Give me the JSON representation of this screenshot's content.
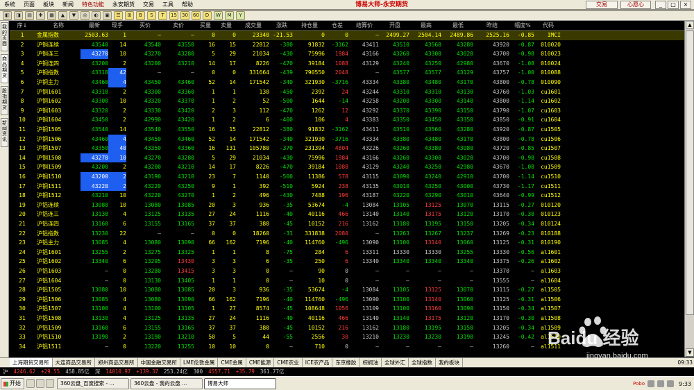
{
  "window": {
    "title": "博易大师-永安期货",
    "menus": [
      "系统",
      "页面",
      "板块",
      "新闻",
      "特色功能",
      "永安期货",
      "交易",
      "工具",
      "帮助"
    ],
    "accent_menu": "特色功能",
    "trade_button": "交易",
    "wish_button": "心愿心",
    "win_controls": [
      "_",
      "□",
      "×"
    ]
  },
  "toolbar": {
    "buttons": [
      "◧",
      "◨",
      "▤",
      "✚",
      "▦",
      "▲",
      "▼",
      "◎",
      "◐",
      "▣",
      "☰",
      "⊞",
      "B",
      "S",
      "T",
      "15",
      "30",
      "60",
      "D",
      "W",
      "M",
      "Y"
    ]
  },
  "left_tabs": [
    "我的页面",
    "商品期货",
    "股指期货",
    "新闻资讯"
  ],
  "left_active": 1,
  "columns": [
    "序↓",
    "名称",
    "最新",
    "现手",
    "买价",
    "卖价",
    "买量",
    "卖量",
    "成交量",
    "涨跌",
    "持仓量",
    "仓差",
    "结算价",
    "开盘",
    "最高",
    "最低",
    "昨结",
    "幅度%",
    "代码"
  ],
  "rows": [
    {
      "seq": "1",
      "name": "金属指数",
      "last": "2503.63",
      "hand": "1",
      "bid": "—",
      "ask": "—",
      "bq": "0",
      "aq": "0",
      "vol": "23340",
      "chg": "-21.53",
      "oi": "0",
      "oid": "0",
      "settle": "—",
      "open": "2499.27",
      "high": "2504.14",
      "low": "2489.86",
      "pre": "2525.16",
      "pct": "-0.85",
      "code": "IMCI",
      "sel": true
    },
    {
      "seq": "2",
      "name": "沪铜连续",
      "last": "43540",
      "hand": "14",
      "bid": "43540",
      "ask": "43550",
      "bq": "16",
      "aq": "15",
      "vol": "22812",
      "chg": "-380",
      "oi": "91832",
      "oid": "-3162",
      "settle": "43411",
      "open": "43510",
      "high": "43560",
      "low": "43280",
      "pre": "43920",
      "pct": "-0.87",
      "code": "010020"
    },
    {
      "seq": "3",
      "name": "沪铜连三",
      "last": "43270",
      "hand": "10",
      "bid": "43270",
      "ask": "43280",
      "bq": "5",
      "aq": "29",
      "vol": "21034",
      "chg": "-430",
      "oi": "75996",
      "oid": "1984",
      "settle": "43166",
      "open": "43260",
      "high": "43300",
      "low": "43020",
      "pre": "43700",
      "pct": "-0.98",
      "code": "010023",
      "hl": [
        "last"
      ]
    },
    {
      "seq": "4",
      "name": "沪铜连四",
      "last": "43200",
      "hand": "2",
      "bid": "43200",
      "ask": "43210",
      "bq": "14",
      "aq": "17",
      "vol": "8226",
      "chg": "-470",
      "oi": "39184",
      "oid": "1088",
      "settle": "43129",
      "open": "43240",
      "high": "43250",
      "low": "42980",
      "pre": "43670",
      "pct": "-1.08",
      "code": "010024"
    },
    {
      "seq": "5",
      "name": "沪铜指数",
      "last": "43318",
      "hand": "42",
      "bid": "—",
      "ask": "—",
      "bq": "0",
      "aq": "0",
      "vol": "331664",
      "chg": "-439",
      "oi": "790550",
      "oid": "2048",
      "settle": "—",
      "open": "43577",
      "high": "43577",
      "low": "43129",
      "pre": "43757",
      "pct": "-1.00",
      "code": "010088",
      "hl": [
        "hand"
      ]
    },
    {
      "seq": "6",
      "name": "沪铜主力",
      "last": "43460",
      "hand": "4",
      "bid": "43450",
      "ask": "43460",
      "bq": "52",
      "aq": "14",
      "vol": "171542",
      "chg": "-340",
      "oi": "321930",
      "oid": "-3716",
      "settle": "43334",
      "open": "43380",
      "high": "43480",
      "low": "43170",
      "pre": "43800",
      "pct": "-0.78",
      "code": "010090",
      "hl": [
        "hand"
      ]
    },
    {
      "seq": "7",
      "name": "沪铜1601",
      "last": "43310",
      "hand": "2",
      "bid": "43300",
      "ask": "43360",
      "bq": "1",
      "aq": "1",
      "vol": "130",
      "chg": "-450",
      "oi": "2392",
      "oid": "24",
      "settle": "43244",
      "open": "43310",
      "high": "43310",
      "low": "43130",
      "pre": "43760",
      "pct": "-1.03",
      "code": "cu1601"
    },
    {
      "seq": "8",
      "name": "沪铜1602",
      "last": "43300",
      "hand": "10",
      "bid": "43320",
      "ask": "43370",
      "bq": "1",
      "aq": "2",
      "vol": "52",
      "chg": "-500",
      "oi": "1644",
      "oid": "-14",
      "settle": "43258",
      "open": "43200",
      "high": "43300",
      "low": "43140",
      "pre": "43800",
      "pct": "-1.14",
      "code": "cu1602"
    },
    {
      "seq": "9",
      "name": "沪铜1603",
      "last": "43320",
      "hand": "2",
      "bid": "43330",
      "ask": "43420",
      "bq": "2",
      "aq": "3",
      "vol": "112",
      "chg": "-470",
      "oi": "1262",
      "oid": "12",
      "settle": "43292",
      "open": "43370",
      "high": "43390",
      "low": "43150",
      "pre": "43790",
      "pct": "-1.07",
      "code": "cu1603"
    },
    {
      "seq": "10",
      "name": "沪铜1604",
      "last": "43450",
      "hand": "2",
      "bid": "42990",
      "ask": "43420",
      "bq": "1",
      "aq": "2",
      "vol": "6",
      "chg": "-400",
      "oi": "106",
      "oid": "4",
      "settle": "43383",
      "open": "43350",
      "high": "43450",
      "low": "43350",
      "pre": "43850",
      "pct": "-0.91",
      "code": "cu1604"
    },
    {
      "seq": "11",
      "name": "沪铜1505",
      "last": "43540",
      "hand": "14",
      "bid": "43540",
      "ask": "43550",
      "bq": "16",
      "aq": "15",
      "vol": "22812",
      "chg": "-380",
      "oi": "91832",
      "oid": "-3162",
      "settle": "43411",
      "open": "43510",
      "high": "43560",
      "low": "43280",
      "pre": "43920",
      "pct": "-0.87",
      "code": "cu1505"
    },
    {
      "seq": "12",
      "name": "沪铜1506",
      "last": "43460",
      "hand": "4",
      "bid": "43450",
      "ask": "43460",
      "bq": "52",
      "aq": "14",
      "vol": "171542",
      "chg": "-340",
      "oi": "321930",
      "oid": "-3716",
      "settle": "43334",
      "open": "43380",
      "high": "43480",
      "low": "43170",
      "pre": "43800",
      "pct": "-0.78",
      "code": "cu1506",
      "hl": [
        "hand"
      ]
    },
    {
      "seq": "13",
      "name": "沪铜1507",
      "last": "43350",
      "hand": "40",
      "bid": "43350",
      "ask": "43360",
      "bq": "16",
      "aq": "131",
      "vol": "105780",
      "chg": "-370",
      "oi": "231394",
      "oid": "4804",
      "settle": "43226",
      "open": "43260",
      "high": "43380",
      "low": "43080",
      "pre": "43720",
      "pct": "-0.85",
      "code": "cu1507",
      "hl": [
        "hand"
      ]
    },
    {
      "seq": "14",
      "name": "沪铜1508",
      "last": "43270",
      "hand": "10",
      "bid": "43270",
      "ask": "43280",
      "bq": "5",
      "aq": "29",
      "vol": "21034",
      "chg": "-430",
      "oi": "75996",
      "oid": "1984",
      "settle": "43166",
      "open": "43260",
      "high": "43300",
      "low": "43020",
      "pre": "43700",
      "pct": "-0.98",
      "code": "cu1508",
      "hl": [
        "last",
        "hand"
      ]
    },
    {
      "seq": "15",
      "name": "沪铜1509",
      "last": "43200",
      "hand": "2",
      "bid": "43200",
      "ask": "43210",
      "bq": "14",
      "aq": "17",
      "vol": "8226",
      "chg": "-470",
      "oi": "39184",
      "oid": "1088",
      "settle": "43129",
      "open": "43240",
      "high": "43250",
      "low": "42980",
      "pre": "43670",
      "pct": "-1.08",
      "code": "cu1509"
    },
    {
      "seq": "16",
      "name": "沪铜1510",
      "last": "43200",
      "hand": "2",
      "bid": "43190",
      "ask": "43210",
      "bq": "23",
      "aq": "7",
      "vol": "1140",
      "chg": "-500",
      "oi": "11386",
      "oid": "578",
      "settle": "43115",
      "open": "43090",
      "high": "43240",
      "low": "42910",
      "pre": "43700",
      "pct": "-1.14",
      "code": "cu1510",
      "hl": [
        "last",
        "hand"
      ]
    },
    {
      "seq": "17",
      "name": "沪铜1511",
      "last": "43220",
      "hand": "2",
      "bid": "43220",
      "ask": "43250",
      "bq": "9",
      "aq": "1",
      "vol": "392",
      "chg": "-510",
      "oi": "5924",
      "oid": "238",
      "settle": "43135",
      "open": "43010",
      "high": "43250",
      "low": "43000",
      "pre": "43730",
      "pct": "-1.17",
      "code": "cu1511",
      "hl": [
        "last",
        "hand"
      ]
    },
    {
      "seq": "18",
      "name": "沪铜1512",
      "last": "43210",
      "hand": "10",
      "bid": "43220",
      "ask": "43270",
      "bq": "1",
      "aq": "2",
      "vol": "496",
      "chg": "-430",
      "oi": "7488",
      "oid": "196",
      "settle": "43187",
      "open": "43220",
      "high": "43290",
      "low": "43010",
      "pre": "43640",
      "pct": "-0.99",
      "code": "cu1512"
    },
    {
      "seq": "19",
      "name": "沪铝连续",
      "last": "13080",
      "hand": "10",
      "bid": "13080",
      "ask": "13085",
      "bq": "20",
      "aq": "3",
      "vol": "936",
      "chg": "-35",
      "oi": "53674",
      "oid": "-4",
      "settle": "13084",
      "open": "13105",
      "high": "13125",
      "low": "13070",
      "pre": "13115",
      "pct": "-0.27",
      "code": "010120"
    },
    {
      "seq": "20",
      "name": "沪铝连三",
      "last": "13130",
      "hand": "4",
      "bid": "13125",
      "ask": "13135",
      "bq": "27",
      "aq": "24",
      "vol": "1116",
      "chg": "-40",
      "oi": "40116",
      "oid": "466",
      "settle": "13140",
      "open": "13140",
      "high": "13175",
      "low": "13120",
      "pre": "13170",
      "pct": "-0.30",
      "code": "010123"
    },
    {
      "seq": "21",
      "name": "沪铝连四",
      "last": "13160",
      "hand": "6",
      "bid": "13155",
      "ask": "13165",
      "bq": "37",
      "aq": "37",
      "vol": "380",
      "chg": "-45",
      "oi": "10152",
      "oid": "216",
      "settle": "13162",
      "open": "13180",
      "high": "13195",
      "low": "13150",
      "pre": "13205",
      "pct": "-0.34",
      "code": "010124"
    },
    {
      "seq": "22",
      "name": "沪铝指数",
      "last": "13230",
      "hand": "22",
      "bid": "—",
      "ask": "—",
      "bq": "0",
      "aq": "0",
      "vol": "18260",
      "chg": "-31",
      "oi": "331838",
      "oid": "2080",
      "settle": "—",
      "open": "13263",
      "high": "13267",
      "low": "13237",
      "pre": "13269",
      "pct": "-0.23",
      "code": "010188"
    },
    {
      "seq": "23",
      "name": "沪铝主力",
      "last": "13085",
      "hand": "4",
      "bid": "13080",
      "ask": "13090",
      "bq": "66",
      "aq": "162",
      "vol": "7196",
      "chg": "-40",
      "oi": "114760",
      "oid": "-496",
      "settle": "13090",
      "open": "13100",
      "high": "13140",
      "low": "13060",
      "pre": "13125",
      "pct": "-0.31",
      "code": "010190"
    },
    {
      "seq": "24",
      "name": "沪铝1601",
      "last": "13255",
      "hand": "2",
      "bid": "13275",
      "ask": "13325",
      "bq": "1",
      "aq": "1",
      "vol": "8",
      "chg": "-75",
      "oi": "284",
      "oid": "6",
      "settle": "13311",
      "open": "13330",
      "high": "13330",
      "low": "13255",
      "pre": "13330",
      "pct": "-0.56",
      "code": "al1601"
    },
    {
      "seq": "25",
      "name": "沪铝1602",
      "last": "13340",
      "hand": "6",
      "bid": "13295",
      "ask": "13430",
      "bq": "3",
      "aq": "3",
      "vol": "6",
      "chg": "-35",
      "oi": "250",
      "oid": "6",
      "settle": "13340",
      "open": "13340",
      "high": "13340",
      "low": "13340",
      "pre": "13375",
      "pct": "-0.26",
      "code": "al1602"
    },
    {
      "seq": "26",
      "name": "沪铝1603",
      "last": "—",
      "hand": "0",
      "bid": "13280",
      "ask": "13415",
      "bq": "3",
      "aq": "3",
      "vol": "0",
      "chg": "—",
      "oi": "90",
      "oid": "0",
      "settle": "—",
      "open": "—",
      "high": "—",
      "low": "—",
      "pre": "13370",
      "pct": "—",
      "code": "al1603"
    },
    {
      "seq": "27",
      "name": "沪铝1604",
      "last": "—",
      "hand": "0",
      "bid": "13130",
      "ask": "13405",
      "bq": "1",
      "aq": "1",
      "vol": "0",
      "chg": "—",
      "oi": "10",
      "oid": "0",
      "settle": "—",
      "open": "—",
      "high": "—",
      "low": "—",
      "pre": "13555",
      "pct": "—",
      "code": "al1604"
    },
    {
      "seq": "28",
      "name": "沪铝1505",
      "last": "13080",
      "hand": "10",
      "bid": "13080",
      "ask": "13085",
      "bq": "20",
      "aq": "3",
      "vol": "936",
      "chg": "-35",
      "oi": "53674",
      "oid": "-4",
      "settle": "13084",
      "open": "13105",
      "high": "13125",
      "low": "13070",
      "pre": "13115",
      "pct": "-0.27",
      "code": "al1505"
    },
    {
      "seq": "29",
      "name": "沪铝1506",
      "last": "13085",
      "hand": "4",
      "bid": "13080",
      "ask": "13090",
      "bq": "66",
      "aq": "162",
      "vol": "7196",
      "chg": "-40",
      "oi": "114760",
      "oid": "-496",
      "settle": "13090",
      "open": "13100",
      "high": "13140",
      "low": "13060",
      "pre": "13125",
      "pct": "-0.31",
      "code": "al1506"
    },
    {
      "seq": "30",
      "name": "沪铝1507",
      "last": "13100",
      "hand": "4",
      "bid": "13100",
      "ask": "13105",
      "bq": "1",
      "aq": "27",
      "vol": "8574",
      "chg": "-45",
      "oi": "108648",
      "oid": "1056",
      "settle": "13109",
      "open": "13100",
      "high": "13160",
      "low": "13090",
      "pre": "13150",
      "pct": "-0.34",
      "code": "al1507"
    },
    {
      "seq": "31",
      "name": "沪铝1508",
      "last": "13130",
      "hand": "4",
      "bid": "13125",
      "ask": "13135",
      "bq": "27",
      "aq": "24",
      "vol": "1116",
      "chg": "-40",
      "oi": "40116",
      "oid": "466",
      "settle": "13140",
      "open": "13140",
      "high": "13175",
      "low": "13120",
      "pre": "13170",
      "pct": "-0.30",
      "code": "al1508"
    },
    {
      "seq": "32",
      "name": "沪铝1509",
      "last": "13160",
      "hand": "6",
      "bid": "13155",
      "ask": "13165",
      "bq": "37",
      "aq": "37",
      "vol": "380",
      "chg": "-45",
      "oi": "10152",
      "oid": "216",
      "settle": "13162",
      "open": "13180",
      "high": "13195",
      "low": "13150",
      "pre": "13205",
      "pct": "-0.34",
      "code": "al1509"
    },
    {
      "seq": "33",
      "name": "沪铝1510",
      "last": "13190",
      "hand": "2",
      "bid": "13190",
      "ask": "13210",
      "bq": "50",
      "aq": "5",
      "vol": "44",
      "chg": "-55",
      "oi": "2556",
      "oid": "30",
      "settle": "13210",
      "open": "13230",
      "high": "13230",
      "low": "13190",
      "pre": "13245",
      "pct": "-0.42",
      "code": "al1510"
    },
    {
      "seq": "34",
      "name": "沪铝1511",
      "last": "—",
      "hand": "0",
      "bid": "13220",
      "ask": "13255",
      "bq": "10",
      "aq": "10",
      "vol": "0",
      "chg": "—",
      "oi": "710",
      "oid": "0",
      "settle": "—",
      "open": "—",
      "high": "—",
      "low": "—",
      "pre": "13260",
      "pct": "—",
      "code": "al1511"
    }
  ],
  "bottom_tabs": [
    "上海期货交易所",
    "大连商品交易所",
    "郑州商品交易所",
    "中国金融交易所",
    "LME伦敦金属",
    "CME金属",
    "CME能源",
    "CME农业",
    "ICE农产品",
    "东京橡胶",
    "棕榈油",
    "全球外汇",
    "全球指数",
    "我的板块"
  ],
  "bottom_active": 0,
  "bottom_time": "09:33",
  "status": [
    {
      "text": "沪",
      "color": "#c8c8c8"
    },
    {
      "text": "4246.62",
      "color": "#ff3c3c"
    },
    {
      "text": "+29.55",
      "color": "#ff3c3c"
    },
    {
      "text": "458.85亿",
      "color": "#c8c8c8"
    },
    {
      "text": "深",
      "color": "#c8c8c8"
    },
    {
      "text": "14010.97",
      "color": "#ff3c3c"
    },
    {
      "text": "+139.37",
      "color": "#ff3c3c"
    },
    {
      "text": "253.24亿",
      "color": "#c8c8c8"
    },
    {
      "text": "300",
      "color": "#c8c8c8"
    },
    {
      "text": "4557.71",
      "color": "#ff3c3c"
    },
    {
      "text": "+35.79",
      "color": "#ff3c3c"
    },
    {
      "text": "361.77亿",
      "color": "#c8c8c8"
    }
  ],
  "taskbar": {
    "start": "开始",
    "tasks": [
      "360云盘_百度搜索 - ...",
      "360云盘 - 我的云盘 ...",
      "博易大师"
    ],
    "active_task": 2,
    "tray_label": "Pobo",
    "time": "9:33"
  },
  "watermark": {
    "brand": "Baidu 经验",
    "url": "jingyan.baidu.com"
  }
}
